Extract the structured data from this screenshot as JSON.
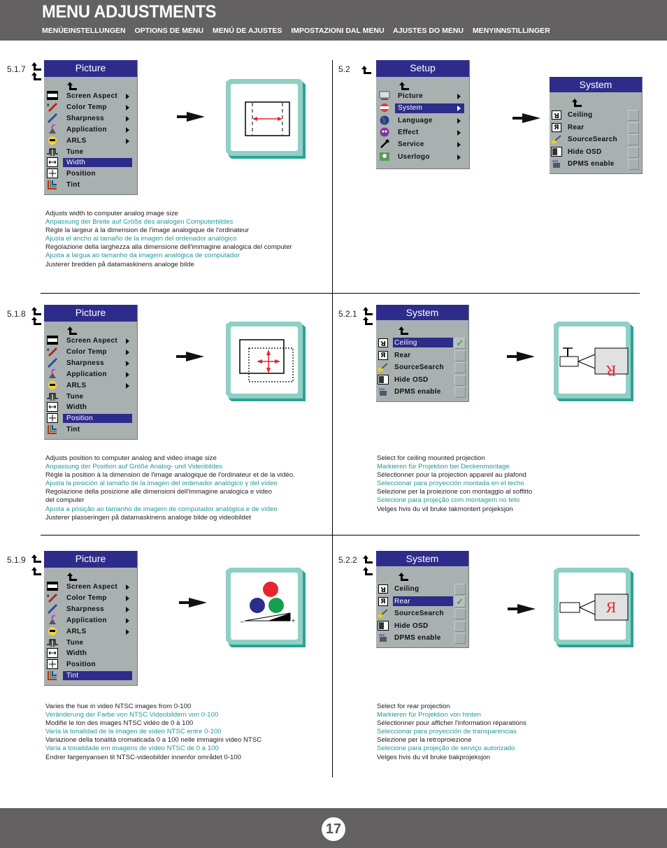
{
  "header": {
    "title": "MENU ADJUSTMENTS",
    "subtitles": [
      "MENÜEINSTELLUNGEN",
      "OPTIONS DE MENU",
      "MENÚ DE AJUSTES",
      "IMPOSTAZIONI DAL MENU",
      "AJUSTES DO MENU",
      "MENYINNSTILLINGER"
    ]
  },
  "picture_menu": {
    "title": "Picture",
    "items": [
      "Screen Aspect",
      "Color Temp",
      "Sharpness",
      "Application",
      "ARLS",
      "Tune",
      "Width",
      "Position",
      "Tint"
    ],
    "icons": [
      "screen-aspect-icon",
      "thermometer-icon",
      "sharpness-icon",
      "application-icon",
      "sun-icon",
      "tune-icon",
      "width-icon",
      "position-icon",
      "tint-icon"
    ],
    "submenu": [
      true,
      true,
      true,
      true,
      true,
      false,
      false,
      false,
      false
    ]
  },
  "setup_menu": {
    "title": "Setup",
    "items": [
      "Picture",
      "System",
      "Language",
      "Effect",
      "Service",
      "Userlogo"
    ],
    "selected": "System"
  },
  "system_menu": {
    "title": "System",
    "items": [
      "Ceiling",
      "Rear",
      "SourceSearch",
      "Hide OSD",
      "DPMS enable"
    ]
  },
  "sections": {
    "s517": {
      "number": "5.1.7",
      "selected": "Width",
      "description": [
        {
          "text": "Adjusts width to computer analog image size",
          "lang": "en"
        },
        {
          "text": "Anpassung der Breite auf Größe des analogen Computerbildes",
          "lang": "de"
        },
        {
          "text": "Règle la largeur à la dimension de l'image analogique de l'ordinateur",
          "lang": "fr"
        },
        {
          "text": "Ajusta el ancho al tamaño de la imagen del ordenador analógico",
          "lang": "es"
        },
        {
          "text": "Regolazione della larghezza alla dimensione dell'immagine analogica del computer",
          "lang": "it"
        },
        {
          "text": "Ajusta a largua ao tamanho da imagem analógica de computador",
          "lang": "pt"
        },
        {
          "text": "Justerer bredden på datamaskinens analoge bilde",
          "lang": "no"
        }
      ]
    },
    "s52": {
      "number": "5.2"
    },
    "s518": {
      "number": "5.1.8",
      "selected": "Position",
      "description": [
        {
          "text": "Adjusts position to computer analog and video image size",
          "lang": "en"
        },
        {
          "text": "Anpassung der Position auf Größe Analog- und Videobildes",
          "lang": "de"
        },
        {
          "text": "Règle la position à la dimension de l'image analogique de l'ordinateur et de la vidéo.",
          "lang": "fr"
        },
        {
          "text": "Ajusta la posición al tamaño de la imagen del ordenador analógico y del vídeo",
          "lang": "es"
        },
        {
          "text": "Regolazione della posizione alle dimensioni dell'immagine analogica e video",
          "lang": "it"
        },
        {
          "text": "del computer",
          "lang": "it"
        },
        {
          "text": "Ajusta a posição ao tamanho de imagem de computador analógica e de vídeo",
          "lang": "pt"
        },
        {
          "text": "Justerer plasseringen på datamaskinens analoge bilde og videobildet",
          "lang": "no"
        }
      ]
    },
    "s521": {
      "number": "5.2.1",
      "selected": "Ceiling",
      "checked": [
        true,
        false,
        false,
        false,
        false
      ],
      "screen_letter": "R",
      "description": [
        {
          "text": "Select for ceiling mounted projection",
          "lang": "en"
        },
        {
          "text": "Markieren für Projektion bei Deckenmontage",
          "lang": "de"
        },
        {
          "text": "Sélectionner pour la projection appareil au plafond",
          "lang": "fr"
        },
        {
          "text": "Seleccionar para proyección montada en el techo",
          "lang": "es"
        },
        {
          "text": "Selezione per la proiezione con montaggio al soffitto",
          "lang": "it"
        },
        {
          "text": "Selecione para projeção com montagem no teto",
          "lang": "pt"
        },
        {
          "text": "Velges hvis du vil bruke takmontert projeksjon",
          "lang": "no"
        }
      ]
    },
    "s519": {
      "number": "5.1.9",
      "selected": "Tint",
      "description": [
        {
          "text": "Varies the hue in video NTSC images from 0-100",
          "lang": "en"
        },
        {
          "text": "Veränderung der Farbe von NTSC Videobildern von 0-100",
          "lang": "de"
        },
        {
          "text": "Modifie le ton des images NTSC vidéo de 0 à 100",
          "lang": "fr"
        },
        {
          "text": "Varía la tonalidad de la imagen de vídeo NTSC entre 0-100",
          "lang": "es"
        },
        {
          "text": "Variazione della tonalità cromaticada 0 a 100 nelle immagini video NTSC",
          "lang": "it"
        },
        {
          "text": "Varia a tonalidade em imagens de vídeo NTSC de 0 a 100",
          "lang": "pt"
        },
        {
          "text": "Endrer fargenyansen til NTSC-videobilder innenfor området 0-100",
          "lang": "no"
        }
      ],
      "slider": {
        "minus": "–",
        "plus": "+"
      }
    },
    "s522": {
      "number": "5.2.2",
      "selected": "Rear",
      "checked": [
        false,
        true,
        false,
        false,
        false
      ],
      "screen_letter": "Я",
      "description": [
        {
          "text": "Select for rear projection",
          "lang": "en"
        },
        {
          "text": "Markieren für Projektion von hinten",
          "lang": "de"
        },
        {
          "text": "Sélectionner pour afficher l'information réparations",
          "lang": "fr"
        },
        {
          "text": "Seleccionar para proyección de transparencias",
          "lang": "es"
        },
        {
          "text": "Selezione per la retroproiezione",
          "lang": "it"
        },
        {
          "text": "Selecione para projeção de serviço autorizado",
          "lang": "pt"
        },
        {
          "text": "Velges hvis du vil bruke bakprojeksjon",
          "lang": "no"
        }
      ]
    }
  },
  "colors": {
    "header_bg": "#636162",
    "menu_title_bg": "#2e2c8a",
    "menu_bg": "#a9b0b0",
    "teal_text": "#1f9a96",
    "frame_teal": "#8fd0c6",
    "frame_shadow": "#2aa394",
    "accent_red": "#e8242c",
    "check_green": "#3aa84a"
  },
  "footer": {
    "page_number": "17"
  }
}
